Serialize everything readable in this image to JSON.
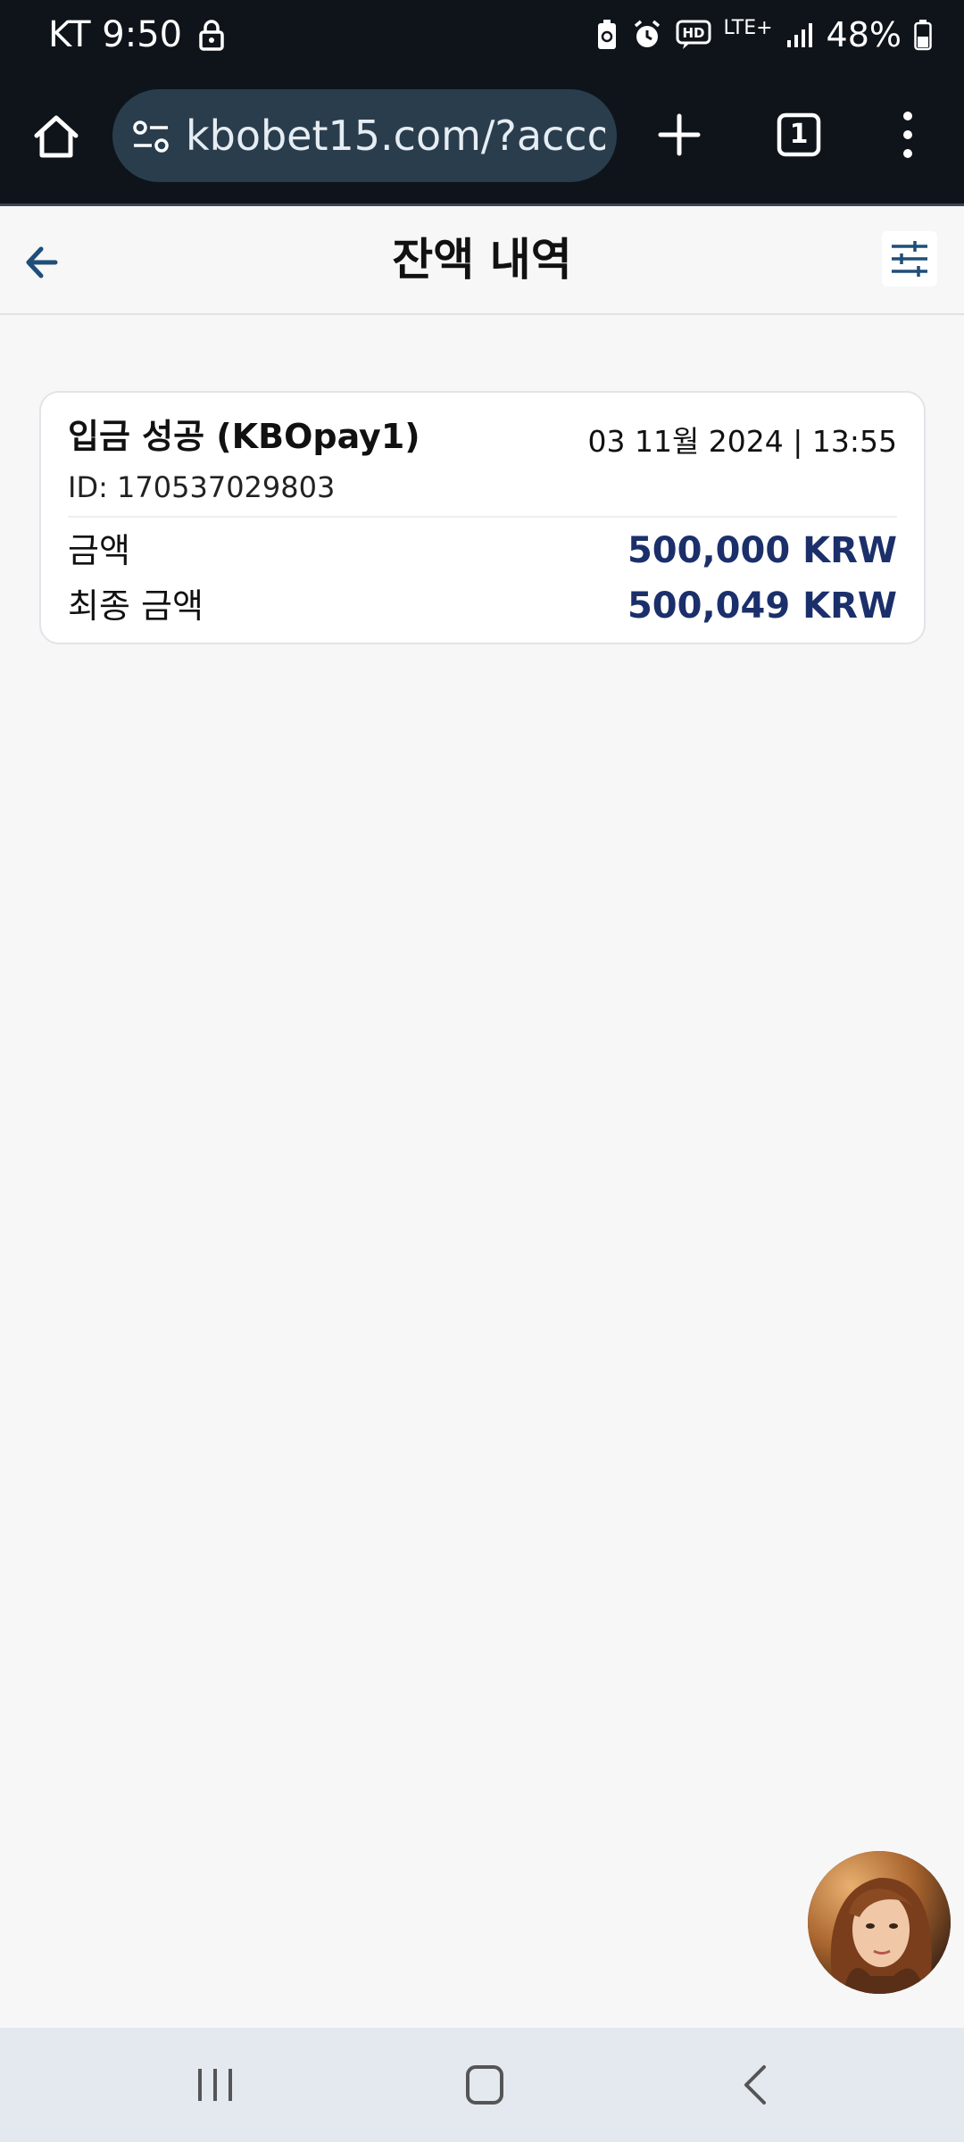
{
  "status_bar": {
    "carrier_time": "KT 9:50",
    "network": "LTE+",
    "battery": "48%"
  },
  "browser": {
    "url": "kbobet15.com/?accou",
    "tab_count": "1"
  },
  "header": {
    "title": "잔액 내역"
  },
  "transaction": {
    "title": "입금 성공 (KBOpay1)",
    "datetime": "03 11월 2024 | 13:55",
    "id_text": "ID: 170537029803",
    "amount_label": "금액",
    "amount_value": "500,000 KRW",
    "final_label": "최종 금액",
    "final_value": "500,049 KRW"
  },
  "colors": {
    "accent_value": "#1b2f6b",
    "status_bar_bg": "#0f141a",
    "url_bar_bg": "#2a3d4d",
    "back_icon": "#1f4e79"
  },
  "icons": [
    "lock-icon",
    "home-icon",
    "site-settings-icon",
    "plus-icon",
    "tabs-icon",
    "menu-icon",
    "back-arrow-icon",
    "filter-icon",
    "recent-apps-icon",
    "home-nav-icon",
    "back-nav-icon"
  ]
}
